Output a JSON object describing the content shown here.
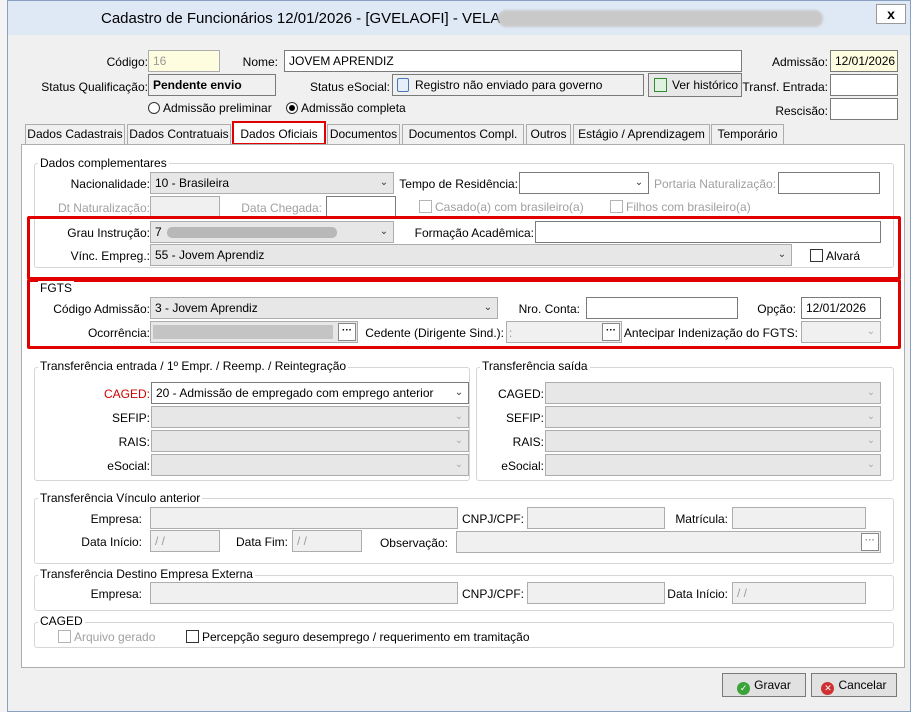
{
  "window": {
    "title": "Cadastro de Funcionários  12/01/2026 - [GVELAOFI] - VELA T",
    "close_label": "x"
  },
  "header": {
    "codigo_label": "Código:",
    "codigo_value": "16",
    "nome_label": "Nome:",
    "nome_value": "JOVEM APRENDIZ",
    "admissao_label": "Admissão:",
    "admissao_value": "12/01/2026",
    "status_qualificacao_label": "Status Qualificação:",
    "status_qualificacao_value": "Pendente envio",
    "status_esocial_label": "Status eSocial:",
    "status_esocial_value": "Registro não enviado para governo",
    "ver_historico_label": "Ver histórico",
    "transf_entrada_label": "Transf. Entrada:",
    "transf_entrada_value": "",
    "rescisao_label": "Rescisão:",
    "rescisao_value": "",
    "radio_preliminar_label": "Admissão preliminar",
    "radio_completa_label": "Admissão completa"
  },
  "tabs": [
    {
      "label": "Dados Cadastrais"
    },
    {
      "label": "Dados Contratuais"
    },
    {
      "label": "Dados Oficiais"
    },
    {
      "label": "Documentos"
    },
    {
      "label": "Documentos Compl."
    },
    {
      "label": "Outros"
    },
    {
      "label": "Estágio / Aprendizagem"
    },
    {
      "label": "Temporário"
    }
  ],
  "complementares": {
    "group_label": "Dados complementares",
    "nacionalidade_label": "Nacionalidade:",
    "nacionalidade_value": "10  -  Brasileira",
    "tempo_residencia_label": "Tempo de Residência:",
    "tempo_residencia_value": "",
    "portaria_label": "Portaria Naturalização:",
    "dt_naturalizacao_label": "Dt Naturalização:",
    "data_chegada_label": "Data Chegada:",
    "casado_label": "Casado(a) com brasileiro(a)",
    "filhos_label": "Filhos com brasileiro(a)",
    "grau_instrucao_label": "Grau Instrução:",
    "grau_instrucao_value": "7",
    "formacao_label": "Formação Acadêmica:",
    "formacao_value": "",
    "vinc_empreg_label": "Vínc. Empreg.:",
    "vinc_empreg_value": "55  -  Jovem Aprendiz",
    "alvara_label": "Alvará"
  },
  "fgts": {
    "group_label": "FGTS",
    "codigo_admissao_label": "Código Admissão:",
    "codigo_admissao_value": "3 - Jovem Aprendiz",
    "nro_conta_label": "Nro. Conta:",
    "nro_conta_value": "",
    "opcao_label": "Opção:",
    "opcao_value": "12/01/2026",
    "ocorrencia_label": "Ocorrência:",
    "cedente_label": "Cedente (Dirigente Sind.):",
    "antecipar_label": "Antecipar Indenização do FGTS:",
    "dots_label": "···"
  },
  "transf_entrada": {
    "group_label": "Transferência entrada / 1º Empr. / Reemp. / Reintegração",
    "caged_label": "CAGED:",
    "caged_value": "20  -  Admissão de empregado com emprego anterior",
    "sefip_label": "SEFIP:",
    "rais_label": "RAIS:",
    "esocial_label": "eSocial:"
  },
  "transf_saida": {
    "group_label": "Transferência saída",
    "caged_label": "CAGED:",
    "sefip_label": "SEFIP:",
    "rais_label": "RAIS:",
    "esocial_label": "eSocial:"
  },
  "vinculo_anterior": {
    "group_label": "Transferência Vínculo anterior",
    "empresa_label": "Empresa:",
    "cnpj_label": "CNPJ/CPF:",
    "matricula_label": "Matrícula:",
    "data_inicio_label": "Data Início:",
    "data_inicio_value": "/ /",
    "data_fim_label": "Data Fim:",
    "data_fim_value": "/ /",
    "observacao_label": "Observação:"
  },
  "destino_externa": {
    "group_label": "Transferência Destino Empresa Externa",
    "empresa_label": "Empresa:",
    "cnpj_label": "CNPJ/CPF:",
    "data_inicio_label": "Data Início:",
    "data_inicio_value": "/ /"
  },
  "caged": {
    "group_label": "CAGED",
    "arquivo_label": "Arquivo gerado",
    "percepcao_label": "Percepção seguro desemprego / requerimento em tramitação"
  },
  "footer": {
    "gravar_label": "Gravar",
    "cancelar_label": "Cancelar"
  },
  "colors": {
    "highlight_red": "#e00000",
    "gravar_icon": "#3aa33a",
    "cancelar_icon": "#d03030"
  }
}
